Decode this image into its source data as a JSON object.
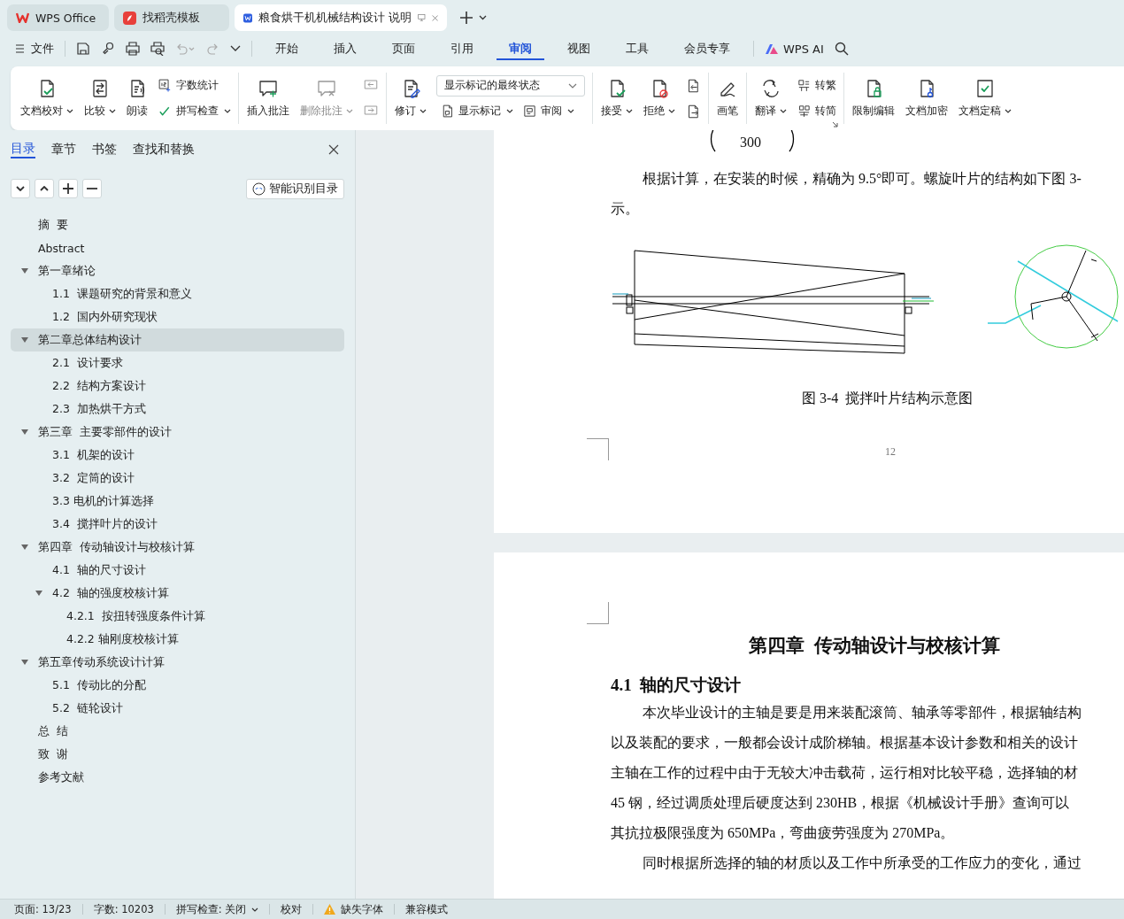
{
  "tabs": [
    {
      "label": "WPS Office",
      "selected": false
    },
    {
      "label": "找稻壳模板",
      "selected": false
    },
    {
      "label": "粮食烘干机机械结构设计 说明",
      "selected": true
    }
  ],
  "menu": {
    "file": "文件",
    "tabs": [
      {
        "label": "开始",
        "selected": false
      },
      {
        "label": "插入",
        "selected": false
      },
      {
        "label": "页面",
        "selected": false
      },
      {
        "label": "引用",
        "selected": false
      },
      {
        "label": "审阅",
        "selected": true
      },
      {
        "label": "视图",
        "selected": false
      },
      {
        "label": "工具",
        "selected": false
      },
      {
        "label": "会员专享",
        "selected": false
      }
    ],
    "ai": "WPS AI"
  },
  "ribbon": [
    {
      "items": [
        {
          "kind": "large",
          "label": "文档校对",
          "dropdown": true,
          "disabled": false
        },
        {
          "kind": "large",
          "label": "比较",
          "dropdown": true,
          "disabled": false
        },
        {
          "kind": "large",
          "label": "朗读",
          "dropdown": false,
          "disabled": false
        },
        {
          "kind": "stack",
          "entries": [
            {
              "label": "字数统计",
              "dropdown": false,
              "disabled": false
            },
            {
              "label": "拼写检查",
              "dropdown": true,
              "disabled": false
            }
          ]
        }
      ]
    },
    {
      "items": [
        {
          "kind": "large",
          "label": "插入批注",
          "dropdown": false,
          "disabled": false
        },
        {
          "kind": "large",
          "label": "删除批注",
          "dropdown": true,
          "disabled": true
        },
        {
          "kind": "icon-stack",
          "entries": [
            {
              "disabled": true
            },
            {
              "disabled": true
            }
          ]
        }
      ]
    },
    {
      "items": [
        {
          "kind": "large",
          "label": "修订",
          "dropdown": true,
          "disabled": false
        },
        {
          "kind": "select-stack",
          "value": "显示标记的最终状态",
          "entries": [
            {
              "label": "显示标记",
              "dropdown": true,
              "disabled": false
            },
            {
              "label": "审阅",
              "dropdown": true,
              "disabled": false
            }
          ]
        }
      ]
    },
    {
      "items": [
        {
          "kind": "large",
          "label": "接受",
          "dropdown": true,
          "disabled": false
        },
        {
          "kind": "large",
          "label": "拒绝",
          "dropdown": true,
          "disabled": false
        },
        {
          "kind": "icon-stack",
          "entries": [
            {
              "disabled": false
            },
            {
              "disabled": false
            }
          ]
        }
      ]
    },
    {
      "items": [
        {
          "kind": "large",
          "label": "画笔",
          "dropdown": false,
          "disabled": false
        }
      ]
    },
    {
      "launcher": true,
      "items": [
        {
          "kind": "large",
          "label": "翻译",
          "dropdown": true,
          "disabled": false
        },
        {
          "kind": "stack",
          "entries": [
            {
              "label": "转繁",
              "dropdown": false,
              "disabled": false
            },
            {
              "label": "转简",
              "dropdown": false,
              "disabled": false
            }
          ]
        }
      ]
    },
    {
      "items": [
        {
          "kind": "large",
          "label": "限制编辑",
          "dropdown": false,
          "disabled": false
        },
        {
          "kind": "large",
          "label": "文档加密",
          "dropdown": false,
          "disabled": false
        },
        {
          "kind": "large",
          "label": "文档定稿",
          "dropdown": true,
          "disabled": false
        }
      ]
    }
  ],
  "nav": {
    "tabs": [
      {
        "label": "目录",
        "selected": true
      },
      {
        "label": "章节",
        "selected": false
      },
      {
        "label": "书签",
        "selected": false
      },
      {
        "label": "查找和替换",
        "selected": false
      }
    ],
    "smart_button": "智能识别目录",
    "toc": [
      {
        "label": "摘  要",
        "selected": false
      },
      {
        "label": "Abstract",
        "selected": false
      },
      {
        "label": "第一章绪论",
        "selected": false,
        "expanded": true,
        "children": [
          {
            "label": "1.1  课题研究的背景和意义",
            "selected": false
          },
          {
            "label": "1.2  国内外研究现状",
            "selected": false
          }
        ]
      },
      {
        "label": "第二章总体结构设计",
        "selected": true,
        "expanded": true,
        "children": [
          {
            "label": "2.1  设计要求",
            "selected": false
          },
          {
            "label": "2.2  结构方案设计",
            "selected": false
          },
          {
            "label": "2.3  加热烘干方式",
            "selected": false
          }
        ]
      },
      {
        "label": "第三章  主要零部件的设计",
        "selected": false,
        "expanded": true,
        "children": [
          {
            "label": "3.1  机架的设计",
            "selected": false
          },
          {
            "label": "3.2  定筒的设计",
            "selected": false
          },
          {
            "label": "3.3 电机的计算选择",
            "selected": false
          },
          {
            "label": "3.4  搅拌叶片的设计",
            "selected": false
          }
        ]
      },
      {
        "label": "第四章  传动轴设计与校核计算",
        "selected": false,
        "expanded": true,
        "children": [
          {
            "label": "4.1  轴的尺寸设计",
            "selected": false
          },
          {
            "label": "4.2  轴的强度校核计算",
            "selected": false,
            "expanded": true,
            "children": [
              {
                "label": "4.2.1  按扭转强度条件计算",
                "selected": false
              },
              {
                "label": "4.2.2 轴刚度校核计算",
                "selected": false
              }
            ]
          }
        ]
      },
      {
        "label": "第五章传动系统设计计算",
        "selected": false,
        "expanded": true,
        "children": [
          {
            "label": "5.1  传动比的分配",
            "selected": false
          },
          {
            "label": "5.2  链轮设计",
            "selected": false
          }
        ]
      },
      {
        "label": "总  结",
        "selected": false
      },
      {
        "label": "致  谢",
        "selected": false
      },
      {
        "label": "参考文献",
        "selected": false
      }
    ]
  },
  "document": {
    "pages": [
      {
        "blocks": [
          {
            "kind": "formula",
            "denominator": "300"
          },
          {
            "kind": "paragraph",
            "lines": [
              "根据计算，在安装的时候，精确为 9.5°即可。螺旋叶片的结构如下图 3-",
              "示。"
            ]
          },
          {
            "kind": "figure"
          },
          {
            "kind": "caption",
            "text": "图 3-4  搅拌叶片结构示意图"
          },
          {
            "kind": "page-number",
            "text": "12"
          }
        ]
      },
      {
        "blocks": [
          {
            "kind": "chapter-title",
            "text": "第四章  传动轴设计与校核计算"
          },
          {
            "kind": "heading",
            "text": "4.1  轴的尺寸设计"
          },
          {
            "kind": "paragraph",
            "lines": [
              "本次毕业设计的主轴是要是用来装配滚筒、轴承等零部件，根据轴结构",
              "以及装配的要求，一般都会设计成阶梯轴。根据基本设计参数和相关的设计",
              "主轴在工作的过程中由于无较大冲击载荷，运行相对比较平稳，选择轴的材",
              "45 钢，经过调质处理后硬度达到 230HB，根据《机械设计手册》查询可以",
              "其抗拉极限强度为 650MPa，弯曲疲劳强度为 270MPa。"
            ]
          },
          {
            "kind": "paragraph",
            "lines": [
              "同时根据所选择的轴的材质以及工作中所承受的工作应力的变化，通过"
            ]
          }
        ]
      }
    ]
  },
  "status_bar": [
    {
      "text": "页面: 13/23",
      "kind": "text"
    },
    {
      "text": "字数: 10203",
      "kind": "text"
    },
    {
      "text": "拼写检查: 关闭",
      "kind": "dropdown"
    },
    {
      "text": "校对",
      "kind": "text"
    },
    {
      "text": "缺失字体",
      "kind": "warning"
    },
    {
      "text": "兼容模式",
      "kind": "text"
    }
  ]
}
